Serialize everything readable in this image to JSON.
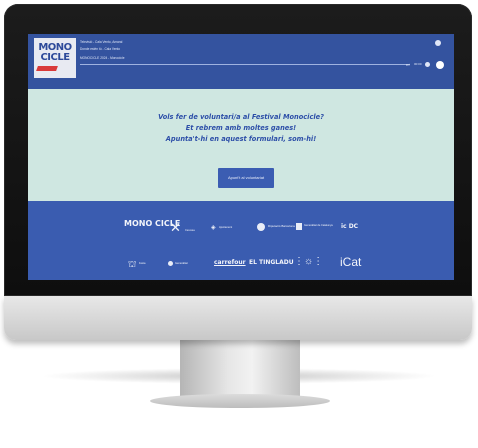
{
  "player": {
    "logo_line1": "MONO",
    "logo_line2": "CICLE",
    "tracks": [
      "Televisió - Cala Vento, Amaral",
      "Donde estén tú - Cala Vento",
      "MONOCICLE 2024 - Monocicle"
    ],
    "time": "00:00",
    "skip_glyph": "⏭",
    "icons": [
      "play-icon",
      "next-icon",
      "menu-icon"
    ]
  },
  "cta_section": {
    "line1": "Vols fer de voluntari/a al Festival Monocicle?",
    "line2": "Et rebrem amb moltes ganes!",
    "line3": "Apunta't-hi en aquest formulari, som-hi!",
    "button_label": "Apunt't al voluntariat"
  },
  "sponsors": {
    "row1": [
      "MONO CICLE",
      "Cervesa",
      "Ajuntament",
      "Diputació Barcelona",
      "Generalitat de Catalunya",
      "ic DC"
    ],
    "row2": [
      "Festa",
      "Generalitat",
      "carrefour",
      "EL TINGLADU",
      "Ingenia",
      "iCat"
    ]
  },
  "colors": {
    "screen_blue": "#3a5cb0",
    "mint": "#cfe7e1",
    "accent_red": "#d93a3a"
  }
}
